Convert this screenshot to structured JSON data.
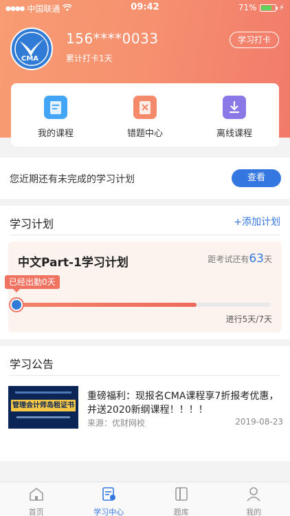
{
  "status_bar": {
    "carrier": "中国联通",
    "time": "09:42",
    "battery": "71%"
  },
  "profile": {
    "phone": "156****0033",
    "punch_days": "累计打卡1天",
    "checkin_label": "学习打卡",
    "avatar_text": "CMA"
  },
  "quick_links": [
    {
      "label": "我的课程",
      "icon": "book-icon",
      "color": "#42a5f5"
    },
    {
      "label": "错题中心",
      "icon": "wrong-book-icon",
      "color": "#f58a6b"
    },
    {
      "label": "离线课程",
      "icon": "download-icon",
      "color": "#8a78e6"
    }
  ],
  "plan_banner": {
    "text": "您近期还有未完成的学习计划",
    "button": "查看"
  },
  "plan_section": {
    "title": "学习计划",
    "add_label": "+添加计划",
    "plan_name": "中文Part-1学习计划",
    "countdown_prefix": "距考试还有",
    "countdown_days": "63",
    "countdown_suffix": "天",
    "attend_tag": "已经出勤0天",
    "progress": 0.71,
    "progress_text": "进行5天/7天"
  },
  "notice_section": {
    "title": "学习公告",
    "items": [
      {
        "thumb_text": "管理会计师岛租证书",
        "title": "重磅福利：现报名CMA课程享7折报考优惠，并送2020新纲课程！！！！",
        "source": "来源：优财网校",
        "date": "2019-08-23"
      }
    ]
  },
  "tabbar": [
    {
      "label": "首页",
      "icon": "home-icon",
      "active": false
    },
    {
      "label": "学习中心",
      "icon": "study-center-icon",
      "active": true
    },
    {
      "label": "题库",
      "icon": "question-bank-icon",
      "active": false
    },
    {
      "label": "我的",
      "icon": "user-icon",
      "active": false
    }
  ],
  "colors": {
    "accent": "#3477e0",
    "header_orange": "#f6906f",
    "progress": "#f07362"
  }
}
